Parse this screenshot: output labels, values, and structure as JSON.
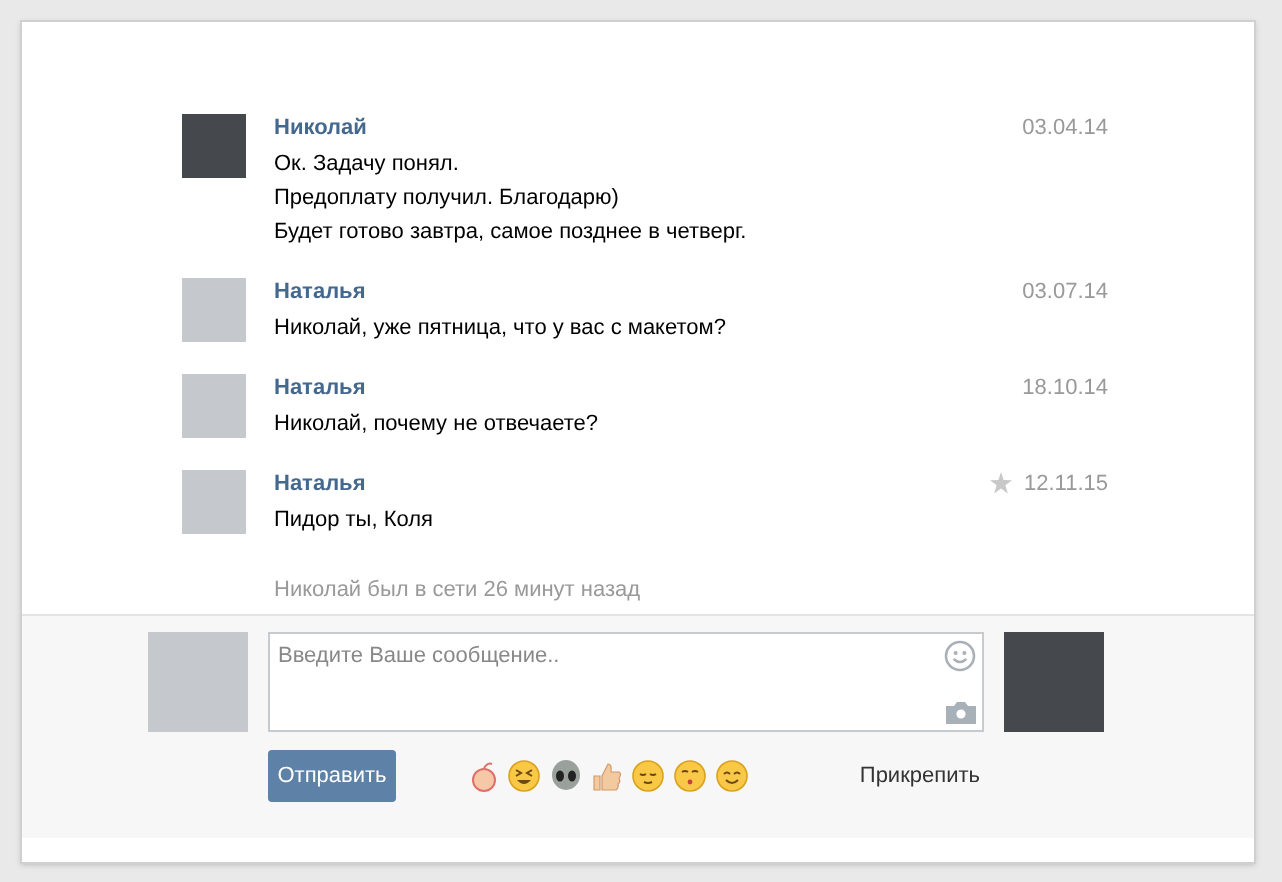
{
  "messages": [
    {
      "author": "Николай",
      "date": "03.04.14",
      "color": "#45484d",
      "starred": false,
      "lines": [
        "Ок. Задачу понял.",
        "Предоплату получил. Благодарю)",
        "Будет готово завтра, самое позднее в четверг."
      ]
    },
    {
      "author": "Наталья",
      "date": "03.07.14",
      "color": "#c5c8cc",
      "starred": false,
      "lines": [
        "Николай, уже пятница, что у вас с макетом?"
      ]
    },
    {
      "author": "Наталья",
      "date": "18.10.14",
      "color": "#c5c8cc",
      "starred": false,
      "lines": [
        "Николай, почему не отвечаете?"
      ]
    },
    {
      "author": "Наталья",
      "date": "12.11.15",
      "color": "#c5c8cc",
      "starred": true,
      "lines": [
        "Пидор ты, Коля"
      ]
    }
  ],
  "status": "Николай был в сети 26 минут назад",
  "composer": {
    "placeholder": "Введите Ваше сообщение..",
    "own_avatar": {
      "color": "#c5c8cc"
    },
    "peer_avatar": {
      "color": "#45484d"
    },
    "send": "Отправить",
    "attach": "Прикрепить"
  }
}
